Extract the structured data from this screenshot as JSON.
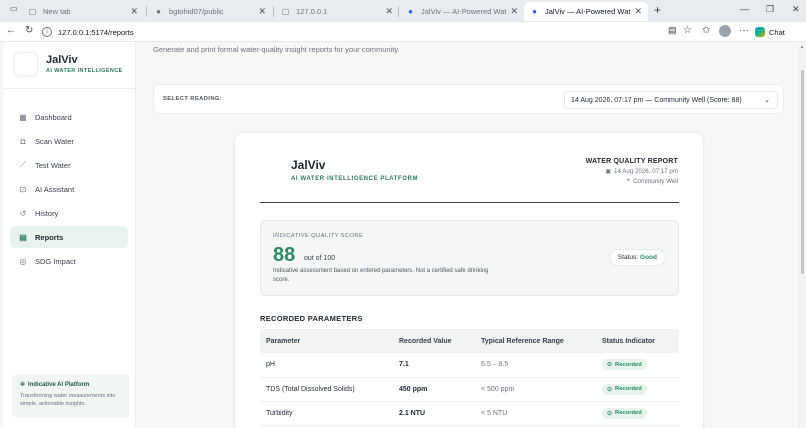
{
  "browser": {
    "tabs": [
      {
        "title": "New tab",
        "icon": "page-icon"
      },
      {
        "title": "bgtohid07/public",
        "icon": "github-icon"
      },
      {
        "title": "127.0.0.1",
        "icon": "page-icon"
      },
      {
        "title": "JalViv — AI-Powered Water Intellig",
        "icon": "water-drop-icon"
      },
      {
        "title": "JalViv — AI-Powered Water Intellig",
        "icon": "water-drop-icon",
        "active": true
      }
    ],
    "url": "127.0.0.1:5174/reports",
    "chat_label": "Chat"
  },
  "sidebar": {
    "brand_name": "JalViv",
    "brand_tagline": "AI WATER INTELLIGENCE",
    "items": [
      {
        "label": "Dashboard",
        "icon": "grid-icon"
      },
      {
        "label": "Scan Water",
        "icon": "camera-icon"
      },
      {
        "label": "Test Water",
        "icon": "pipette-icon"
      },
      {
        "label": "AI Assistant",
        "icon": "bot-icon"
      },
      {
        "label": "History",
        "icon": "history-icon"
      },
      {
        "label": "Reports",
        "icon": "file-icon",
        "active": true
      },
      {
        "label": "SDG Impact",
        "icon": "target-icon"
      }
    ],
    "footer_card": {
      "title": "Indicative AI Platform",
      "description": "Transforming water measurements into simple, actionable insights."
    }
  },
  "main": {
    "subtitle": "Generate and print formal water-quality insight reports for your community.",
    "select_label": "SELECT READING:",
    "selected_reading": "14 Aug 2026, 07:17 pm — Community Well (Score: 88)"
  },
  "report": {
    "brand_name": "JalViv",
    "brand_tagline": "AI WATER INTELLIGENCE PLATFORM",
    "title": "WATER QUALITY REPORT",
    "date": "14 Aug 2026, 07:17 pm",
    "location": "Community Well",
    "score_label": "INDICATIVE QUALITY SCORE",
    "score_value": "88",
    "score_out_of": "out of 100",
    "score_note": "Indicative assessment based on entered parameters. Not a certified safe drinking score.",
    "status_label": "Status:",
    "status_value": "Good",
    "params_title": "RECORDED PARAMETERS",
    "columns": [
      "Parameter",
      "Recorded Value",
      "Typical Reference Range",
      "Status Indicator"
    ],
    "rows": [
      {
        "parameter": "pH",
        "value": "7.1",
        "range": "6.5 – 8.5",
        "status": "Recorded"
      },
      {
        "parameter": "TDS (Total Dissolved Solids)",
        "value": "450 ppm",
        "range": "< 500 ppm",
        "status": "Recorded"
      },
      {
        "parameter": "Turbidity",
        "value": "2.1 NTU",
        "range": "< 5 NTU",
        "status": "Recorded"
      }
    ]
  },
  "colors": {
    "accent": "#2d8a63",
    "active_nav_bg": "#e8f3ee",
    "badge_bg": "#e6f4ec"
  }
}
